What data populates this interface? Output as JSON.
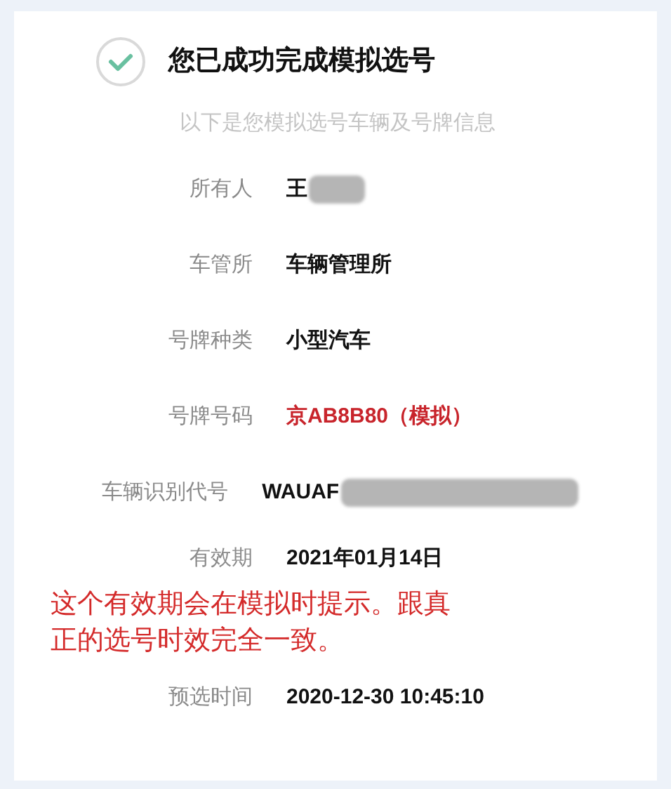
{
  "title": "您已成功完成模拟选号",
  "subtitle": "以下是您模拟选号车辆及号牌信息",
  "rows": [
    {
      "label": "所有人",
      "value": "王",
      "kind": "text",
      "redacted": true
    },
    {
      "label": "车管所",
      "value": "车辆管理所",
      "kind": "text",
      "redacted": false
    },
    {
      "label": "号牌种类",
      "value": "小型汽车",
      "kind": "text",
      "redacted": false
    },
    {
      "label": "号牌号码",
      "value": "京AB8B80（模拟）",
      "kind": "plate",
      "redacted": false
    },
    {
      "label": "车辆识别代号",
      "value": "WAUAF",
      "kind": "text",
      "redacted": true
    },
    {
      "label": "有效期",
      "value": "2021年01月14日",
      "kind": "text",
      "redacted": false,
      "note": "这个有效期会在模拟时提示。跟真正的选号时效完全一致。"
    },
    {
      "label": "预选时间",
      "value": "2020-12-30 10:45:10",
      "kind": "text",
      "redacted": false
    }
  ]
}
